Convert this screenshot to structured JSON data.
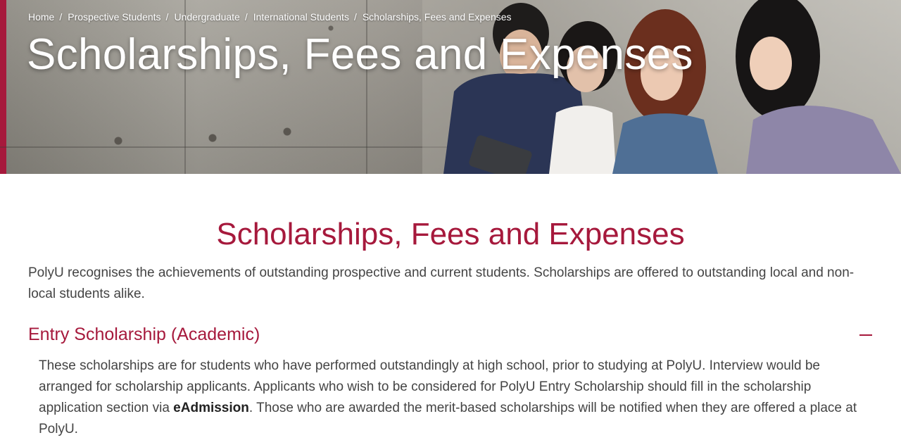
{
  "breadcrumb": {
    "items": [
      "Home",
      "Prospective Students",
      "Undergraduate",
      "International Students",
      "Scholarships, Fees and Expenses"
    ],
    "separator": "/"
  },
  "hero": {
    "title": "Scholarships, Fees and Expenses",
    "image_subject": "students-looking-at-tablet-photo"
  },
  "main": {
    "title": "Scholarships, Fees and Expenses",
    "intro": "PolyU recognises the achievements of outstanding prospective and current students. Scholarships are offered to outstanding local and non-local students alike."
  },
  "accordion": {
    "title": "Entry Scholarship (Academic)",
    "toggle_icon": "minus-icon",
    "body_part1": "These scholarships are for students who have performed outstandingly at high school, prior to studying at PolyU. Interview would be arranged for scholarship applicants. Applicants who wish to be considered for PolyU Entry Scholarship should fill in the scholarship application section via ",
    "body_link": "eAdmission",
    "body_part2": ". Those who are awarded the merit-based scholarships will be notified when they are offered a place at PolyU."
  },
  "colors": {
    "accent": "#a6193c",
    "text": "#444444",
    "hero_text": "#ffffff"
  }
}
